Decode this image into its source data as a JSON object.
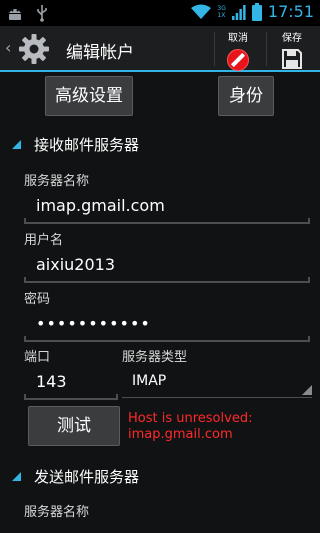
{
  "status_bar": {
    "time": "17:51",
    "net_top": "3G",
    "net_bottom": "1X"
  },
  "action_bar": {
    "title": "编辑帐户",
    "cancel_label": "取消",
    "save_label": "保存",
    "up_glyph": "‹"
  },
  "top_buttons": {
    "advanced": "高级设置",
    "identity": "身份"
  },
  "incoming": {
    "header": "接收邮件服务器",
    "server_label": "服务器名称",
    "server_value": "imap.gmail.com",
    "username_label": "用户名",
    "username_value": "aixiu2013",
    "password_label": "密码",
    "password_value": "•••••••••••",
    "port_label": "端口",
    "port_value": "143",
    "type_label": "服务器类型",
    "type_value": "IMAP",
    "test_button": "测试",
    "error": "Host is unresolved: imap.gmail.com"
  },
  "outgoing": {
    "header": "发送邮件服务器",
    "server_label": "服务器名称"
  },
  "colors": {
    "accent": "#33b5e5",
    "error": "#ff2a2a",
    "background": "#111213",
    "button": "#3b3c3e"
  },
  "icons": [
    "android-icon",
    "usb-icon",
    "wifi-icon",
    "signal-icon",
    "battery-icon",
    "settings-gear-icon",
    "cancel-icon",
    "save-icon"
  ]
}
